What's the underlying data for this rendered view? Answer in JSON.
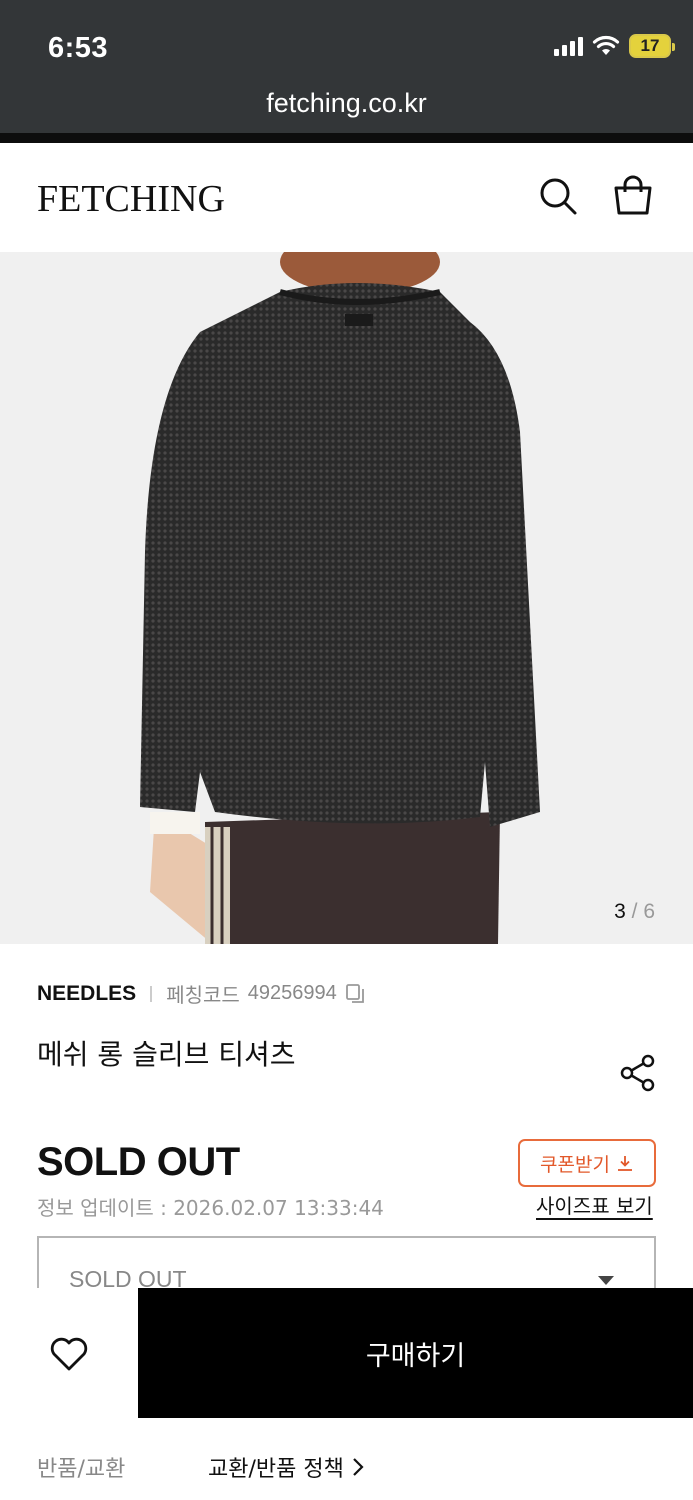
{
  "status_bar": {
    "time": "6:53",
    "battery": "17"
  },
  "browser": {
    "url": "fetching.co.kr"
  },
  "header": {
    "logo": "FETCHING",
    "search_icon": "search-icon",
    "bag_icon": "shopping-bag-icon"
  },
  "gallery": {
    "current": "3",
    "separator": "/",
    "total": "6"
  },
  "product": {
    "brand": "NEEDLES",
    "code_label": "페칭코드",
    "code_value": "49256994",
    "title": "메쉬 롱 슬리브 티셔츠",
    "price_status": "SOLD OUT",
    "updated": "정보 업데이트 : 2026.02.07 13:33:44"
  },
  "actions": {
    "coupon_label": "쿠폰받기",
    "size_chart_label": "사이즈표 보기",
    "option_value": "SOLD OUT",
    "buy_label": "구매하기"
  },
  "policy": {
    "label": "반품/교환",
    "link": "교환/반품 정책"
  },
  "colors": {
    "accent": "#e86b3b",
    "chrome": "#333638",
    "buy_button": "#000000"
  }
}
